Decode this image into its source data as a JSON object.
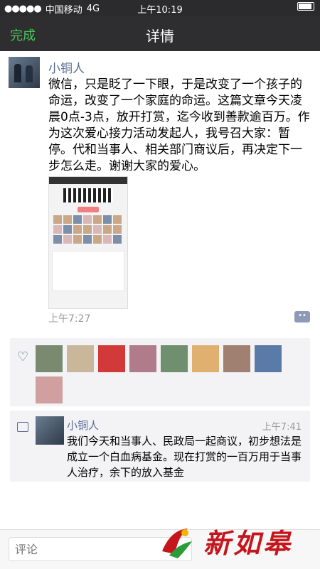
{
  "status": {
    "carrier": "中国移动",
    "network": "4G",
    "time": "上午10:19",
    "signal": "●●●●●"
  },
  "nav": {
    "done": "完成",
    "title": "详情"
  },
  "post": {
    "username": "小铜人",
    "text": "微信，只是眨了一下眼，于是改变了一个孩子的命运，改变了一个家庭的命运。这篇文章今天凌晨0点-3点，放开打赏，迄今收到善款逾百万。作为这次爱心接力活动发起人，我号召大家：暂停。代和当事人、相关部门商议后，再决定下一步怎么走。谢谢大家的爱心。",
    "time": "上午7:27",
    "comment_icon": "comment-bubble-icon"
  },
  "likes": {
    "icon": "heart-icon"
  },
  "comment": {
    "username": "小铜人",
    "time": "上午7:41",
    "text": "我们今天和当事人、民政局一起商议，初步想法是成立一个白血病基金。现在打赏的一百万用于当事人治疗，余下的放入基金"
  },
  "input": {
    "placeholder": "评论"
  },
  "watermark": {
    "text": "新如皋"
  },
  "colors": {
    "link": "#576b95",
    "done": "#4bc45a",
    "watermark": "#c4161c"
  }
}
